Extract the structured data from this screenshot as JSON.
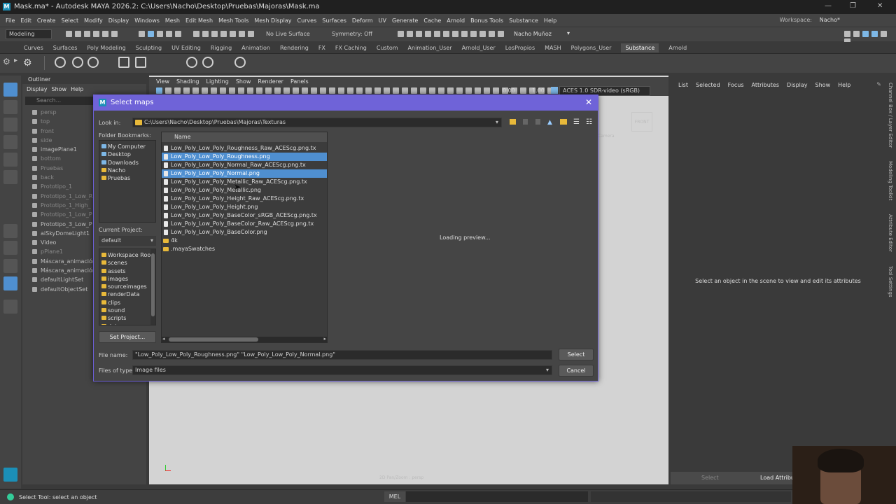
{
  "window": {
    "title": "Mask.ma* - Autodesk MAYA 2026.2: C:\\Users\\Nacho\\Desktop\\Pruebas\\Majoras\\Mask.ma",
    "logo": "M"
  },
  "menubar": {
    "items": [
      "File",
      "Edit",
      "Create",
      "Select",
      "Modify",
      "Display",
      "Windows",
      "Mesh",
      "Edit Mesh",
      "Mesh Tools",
      "Mesh Display",
      "Curves",
      "Surfaces",
      "Deform",
      "UV",
      "Generate",
      "Cache",
      "Arnold",
      "Bonus Tools",
      "Substance",
      "Help"
    ],
    "workspace_label": "Workspace:",
    "workspace_value": "Nacho*"
  },
  "statusline": {
    "mode": "Modeling",
    "live_surface": "No Live Surface",
    "symmetry": "Symmetry: Off",
    "user": "Nacho Muñoz"
  },
  "shelf": {
    "tabs": [
      "Curves",
      "Surfaces",
      "Poly Modeling",
      "Sculpting",
      "UV Editing",
      "Rigging",
      "Animation",
      "Rendering",
      "FX",
      "FX Caching",
      "Custom",
      "Animation_User",
      "Arnold_User",
      "LosPropios",
      "MASH",
      "Polygons_User",
      "Substance",
      "Arnold"
    ],
    "active_tab": "Substance"
  },
  "outliner": {
    "title": "Outliner",
    "menu": [
      "Display",
      "Show",
      "Help"
    ],
    "search_placeholder": "Search...",
    "items": [
      {
        "label": "persp",
        "dim": true
      },
      {
        "label": "top",
        "dim": true
      },
      {
        "label": "front",
        "dim": true
      },
      {
        "label": "side",
        "dim": true
      },
      {
        "label": "imagePlane1",
        "dim": false
      },
      {
        "label": "bottom",
        "dim": true
      },
      {
        "label": "Pruebas",
        "dim": true
      },
      {
        "label": "back",
        "dim": true
      },
      {
        "label": "Prototipo_1",
        "dim": true
      },
      {
        "label": "Prototipo_1_Low_R",
        "dim": true
      },
      {
        "label": "Prototipo_1_High_",
        "dim": true
      },
      {
        "label": "Prototipo_1_Low_P",
        "dim": true
      },
      {
        "label": "Prototipo_3_Low_P",
        "dim": false
      },
      {
        "label": "aiSkyDomeLight1",
        "dim": false
      },
      {
        "label": "Video",
        "dim": false
      },
      {
        "label": "pPlane1",
        "dim": true
      },
      {
        "label": "Máscara_animación",
        "dim": false
      },
      {
        "label": "Máscara_animación",
        "dim": false
      },
      {
        "label": "defaultLightSet",
        "dim": false
      },
      {
        "label": "defaultObjectSet",
        "dim": false
      }
    ]
  },
  "viewport": {
    "menu": [
      "View",
      "Shading",
      "Lighting",
      "Show",
      "Renderer",
      "Panels"
    ],
    "exposure": "0.00",
    "gamma": "1.00",
    "color_space": "ACES 1.0 SDR-video (sRGB)",
    "hud_label": "2D Pan/Zoom : persp",
    "hud_front": "FRONT",
    "hud_camera": "Camera"
  },
  "attribute_editor": {
    "menu": [
      "List",
      "Selected",
      "Focus",
      "Attributes",
      "Display",
      "Show",
      "Help"
    ],
    "message": "Select an object in the scene to view and edit its attributes",
    "select_button": "Select",
    "load_button": "Load Attribut"
  },
  "side_tabs": [
    "Channel Box / Layer Editor",
    "Modeling Toolkit",
    "Attribute Editor",
    "Tool Settings"
  ],
  "helpline": {
    "text": "Select Tool: select an object",
    "mel_label": "MEL"
  },
  "dialog": {
    "title": "Select maps",
    "look_in_label": "Look in:",
    "look_in_path": "C:\\Users\\Nacho\\Desktop\\Pruebas\\Majoras\\Texturas",
    "bookmarks_label": "Folder Bookmarks:",
    "bookmarks": [
      {
        "label": "My Computer",
        "type": "computer"
      },
      {
        "label": "Desktop",
        "type": "computer"
      },
      {
        "label": "Downloads",
        "type": "computer"
      },
      {
        "label": "Nacho",
        "type": "folder"
      },
      {
        "label": "Pruebas",
        "type": "folder"
      }
    ],
    "current_project_label": "Current Project:",
    "current_project": "default",
    "project_folders": [
      "Workspace Root",
      "scenes",
      "assets",
      "images",
      "sourceimages",
      "renderData",
      "clips",
      "sound",
      "scripts",
      "data"
    ],
    "set_project_button": "Set Project...",
    "name_header": "Name",
    "files": [
      {
        "name": "Low_Poly_Low_Poly_Roughness_Raw_ACEScg.png.tx",
        "selected": false,
        "folder": false
      },
      {
        "name": "Low_Poly_Low_Poly_Roughness.png",
        "selected": true,
        "folder": false
      },
      {
        "name": "Low_Poly_Low_Poly_Normal_Raw_ACEScg.png.tx",
        "selected": false,
        "folder": false
      },
      {
        "name": "Low_Poly_Low_Poly_Normal.png",
        "selected": true,
        "folder": false
      },
      {
        "name": "Low_Poly_Low_Poly_Metallic_Raw_ACEScg.png.tx",
        "selected": false,
        "folder": false
      },
      {
        "name": "Low_Poly_Low_Poly_Metallic.png",
        "selected": false,
        "folder": false
      },
      {
        "name": "Low_Poly_Low_Poly_Height_Raw_ACEScg.png.tx",
        "selected": false,
        "folder": false
      },
      {
        "name": "Low_Poly_Low_Poly_Height.png",
        "selected": false,
        "folder": false
      },
      {
        "name": "Low_Poly_Low_Poly_BaseColor_sRGB_ACEScg.png.tx",
        "selected": false,
        "folder": false
      },
      {
        "name": "Low_Poly_Low_Poly_BaseColor_Raw_ACEScg.png.tx",
        "selected": false,
        "folder": false
      },
      {
        "name": "Low_Poly_Low_Poly_BaseColor.png",
        "selected": false,
        "folder": false
      },
      {
        "name": "4k",
        "selected": false,
        "folder": true
      },
      {
        "name": ".mayaSwatches",
        "selected": false,
        "folder": true
      }
    ],
    "preview_text": "Loading preview...",
    "file_name_label": "File name:",
    "file_name_value": "\"Low_Poly_Low_Poly_Roughness.png\" \"Low_Poly_Low_Poly_Normal.png\"",
    "file_type_label": "Files of type:",
    "file_type_value": "Image files",
    "select_button": "Select",
    "cancel_button": "Cancel"
  },
  "colors": {
    "dialog_title_bar": "#6f63d8",
    "selection": "#4f8fd0",
    "maya_logo": "#1b8fb7"
  }
}
